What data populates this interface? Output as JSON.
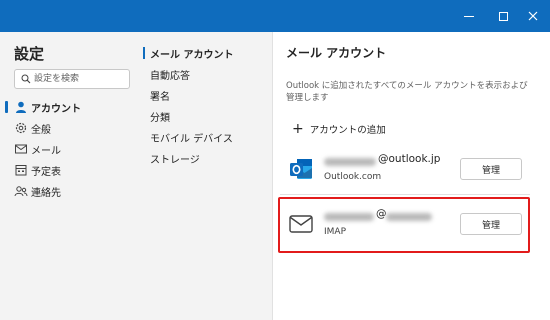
{
  "window": {
    "titlebar_color": "#0f6cbd",
    "controls": [
      "minimize",
      "maximize",
      "close"
    ]
  },
  "sidebar": {
    "title": "設定",
    "search": {
      "placeholder": "設定を検索",
      "value": ""
    },
    "items": [
      {
        "label": "アカウント",
        "icon": "person-icon",
        "active": true
      },
      {
        "label": "全般",
        "icon": "gear-icon",
        "active": false
      },
      {
        "label": "メール",
        "icon": "mail-icon",
        "active": false
      },
      {
        "label": "予定表",
        "icon": "calendar-icon",
        "active": false
      },
      {
        "label": "連絡先",
        "icon": "people-icon",
        "active": false
      }
    ]
  },
  "subnav": {
    "items": [
      {
        "label": "メール アカウント",
        "active": true
      },
      {
        "label": "自動応答",
        "active": false
      },
      {
        "label": "署名",
        "active": false
      },
      {
        "label": "分類",
        "active": false
      },
      {
        "label": "モバイル デバイス",
        "active": false
      },
      {
        "label": "ストレージ",
        "active": false
      }
    ]
  },
  "main": {
    "title": "メール アカウント",
    "description": "Outlook に追加されたすべてのメール アカウントを表示および管理します",
    "add_account_label": "アカウントの追加",
    "accounts": [
      {
        "email_domain": "@outlook.jp",
        "type": "Outlook.com",
        "icon": "outlook-icon",
        "manage_label": "管理"
      },
      {
        "email_domain": "@",
        "type": "IMAP",
        "icon": "envelope-icon",
        "manage_label": "管理",
        "highlighted": true
      }
    ],
    "highlight_color": "#e21b1b"
  }
}
